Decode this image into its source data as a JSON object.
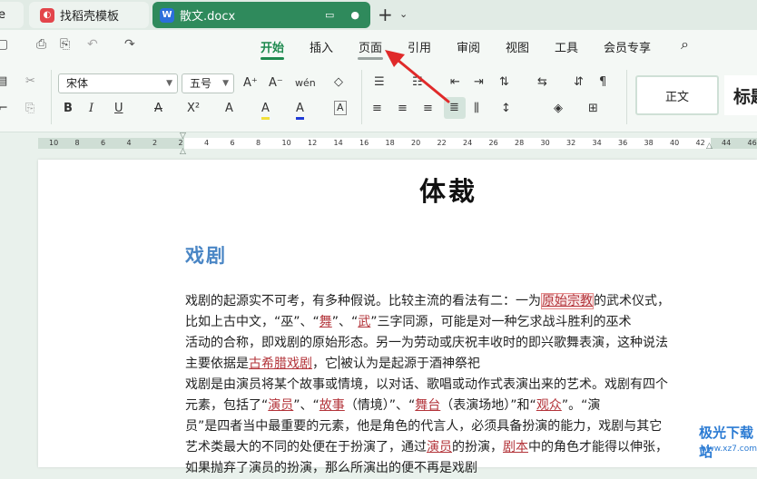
{
  "tabs": {
    "prev_label": "e",
    "template_label": "找稻壳模板",
    "doc_label": "散文.docx",
    "doc_icon_letter": "W",
    "new_tab_glyph": "+",
    "new_tab_chevron": "⌄"
  },
  "menu": {
    "items": [
      "开始",
      "插入",
      "页面",
      "引用",
      "审阅",
      "视图",
      "工具",
      "会员专享"
    ],
    "active": "开始",
    "search_glyph": "⌕",
    "quick_access": [
      "▢",
      "⎙",
      "⎘",
      "↶",
      "↷"
    ]
  },
  "ribbon": {
    "font_name": "宋体",
    "font_size": "五号",
    "grow_font": "A⁺",
    "shrink_font": "A⁻",
    "pinyin": "wén",
    "clear_format": "◇",
    "bold": "B",
    "italic": "I",
    "underline": "U",
    "strike": "A",
    "superscript": "X²",
    "text_effect": "A",
    "highlight": "A",
    "font_color": "A",
    "char_border": "A",
    "style_normal": "正文",
    "style_heading": "标题"
  },
  "ruler": {
    "ticks": [
      "10",
      "8",
      "6",
      "4",
      "2",
      "2",
      "4",
      "6",
      "8",
      "10",
      "12",
      "14",
      "16",
      "18",
      "20",
      "22",
      "24",
      "26",
      "28",
      "30",
      "32",
      "34",
      "36",
      "38",
      "40",
      "42",
      "44",
      "46"
    ]
  },
  "document": {
    "title": "体裁",
    "heading": "戏剧",
    "lines": [
      [
        {
          "t": "戏剧的起源实不可考，有多种假说。比较主流的看法有二：一为"
        },
        {
          "t": "原始宗教",
          "s": "boxed"
        },
        {
          "t": "的武术仪式，"
        }
      ],
      [
        {
          "t": "比如上古中文，“巫”、“"
        },
        {
          "t": "舞",
          "s": "link"
        },
        {
          "t": "”、“"
        },
        {
          "t": "武",
          "s": "link"
        },
        {
          "t": "”三字同源，可能是对一种乞求战斗胜利的巫术"
        }
      ],
      [
        {
          "t": "活动的合称，即戏剧的原始形态。另一为劳动或庆祝丰收时的即兴歌舞表演，这种说法"
        }
      ],
      [
        {
          "t": "主要依据是"
        },
        {
          "t": "古希腊戏剧",
          "s": "link"
        },
        {
          "t": "，它"
        },
        {
          "t": "",
          "s": "caret"
        },
        {
          "t": "被认为是起源于酒神祭祀"
        }
      ],
      [
        {
          "t": "戏剧是由演员将某个故事或情境，以对话、歌唱或动作式表演出来的艺术。戏剧有四个"
        }
      ],
      [
        {
          "t": "元素，包括了“"
        },
        {
          "t": "演员",
          "s": "link"
        },
        {
          "t": "”、“"
        },
        {
          "t": "故事",
          "s": "link"
        },
        {
          "t": "（情境）”、“"
        },
        {
          "t": "舞台",
          "s": "link"
        },
        {
          "t": "（表演场地）”和“"
        },
        {
          "t": "观众",
          "s": "link"
        },
        {
          "t": "”。“演"
        }
      ],
      [
        {
          "t": "员”是四者当中最重要的元素，他是角色的代言人，必须具备扮演的能力，戏剧与其它"
        }
      ],
      [
        {
          "t": "艺术类最大的不同的处便在于扮演了，通过"
        },
        {
          "t": "演员",
          "s": "link"
        },
        {
          "t": "的扮演，"
        },
        {
          "t": "剧本",
          "s": "link"
        },
        {
          "t": "中的角色才能得以伸张，"
        }
      ],
      [
        {
          "t": "如果抛弃了演员的扮演，那么所演出的便不再是戏剧"
        }
      ]
    ]
  },
  "watermark": {
    "text": "极光下载站",
    "sub": "www.xz7.com"
  },
  "colors": {
    "accent_green": "#1e8a4f",
    "doc_tab": "#2f8a5c",
    "heading_blue": "#4a86c5",
    "link_red": "#b3343a",
    "arrow_red": "#e02a2a"
  }
}
